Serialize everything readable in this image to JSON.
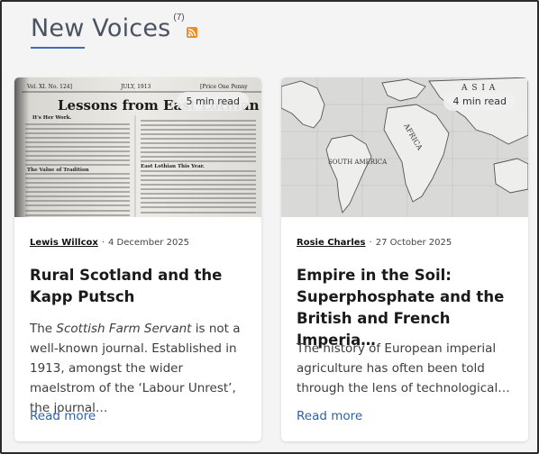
{
  "section": {
    "title": "New Voices",
    "count": "(7)",
    "rss_icon": "rss-feed-icon",
    "accent_color": "#3a6fb5"
  },
  "cards": [
    {
      "read_time": "5 min read",
      "author": "Lewis Willcox",
      "separator": "·",
      "date": "4 December 2025",
      "title": "Rural Scotland and the Kapp Putsch",
      "excerpt_prefix": "The ",
      "excerpt_italic": "Scottish Farm Servant",
      "excerpt_rest": " is not a well-known journal. Established in 1913, amongst the wider maelstrom of the ‘Labour Unrest’, the journal…",
      "read_more": "Read more",
      "image": "newspaper-page",
      "thumb_text": {
        "masthead": "Vol. XI. No. 124]",
        "month": "JULY, 1913",
        "price": "[Price One Penny",
        "headline": "Lessons from East Lothian",
        "col_head_1": "It's Her Work.",
        "col_head_2": "The Value of Tradition",
        "col_head_3": "East Lothian This Year."
      }
    },
    {
      "read_time": "4 min read",
      "author": "Rosie Charles",
      "separator": "·",
      "date": "27 October 2025",
      "title": "Empire in the Soil: Superphosphate and the British and French Imperia…",
      "excerpt": "The history of European imperial agriculture has often been told through the lens of technological…",
      "read_more": "Read more",
      "image": "world-map",
      "map_labels": {
        "asia": "A S I A",
        "africa": "AFRICA",
        "south_america": "SOUTH AMERICA"
      }
    }
  ]
}
